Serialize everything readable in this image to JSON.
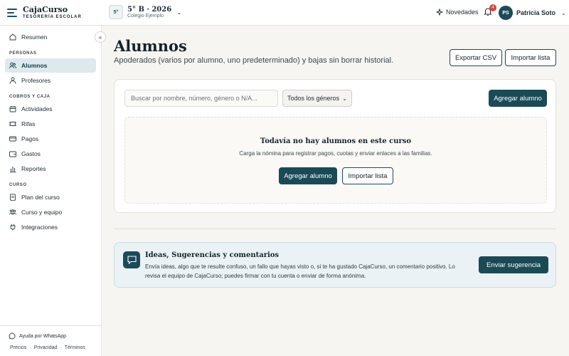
{
  "brand": {
    "name": "CajaCurso",
    "tagline": "TESORERÍA ESCOLAR"
  },
  "course": {
    "badge": "5°",
    "title": "5° B · 2026",
    "school": "Colegio Ejemplo"
  },
  "topbar": {
    "novedades": "Novedades",
    "notifications": "4",
    "avatar_initials": "PS",
    "user_name": "Patricia Soto"
  },
  "sidebar": {
    "collapse": "«",
    "items": {
      "resumen": "Resumen",
      "alumnos": "Alumnos",
      "profesores": "Profesores",
      "actividades": "Actividades",
      "rifas": "Rifas",
      "pagos": "Pagos",
      "gastos": "Gastos",
      "reportes": "Reportes",
      "plan": "Plan del curso",
      "equipo": "Curso y equipo",
      "integraciones": "Integraciones"
    },
    "sections": {
      "personas": "PERSONAS",
      "cobros": "COBROS Y CAJA",
      "curso": "CURSO"
    },
    "active": "alumnos",
    "help": "Ayuda por WhatsApp",
    "footer": {
      "precios": "Precios",
      "privacidad": "Privacidad",
      "terminos": "Términos",
      "sep": "·"
    }
  },
  "main": {
    "title": "Alumnos",
    "subtitle": "Apoderados (varios por alumno, uno predeterminado) y bajas sin borrar historial.",
    "export_label": "Exportar CSV",
    "import_label": "Importar lista",
    "search_placeholder": "Buscar por nombre, número, género o N/A...",
    "gender_filter": "Todos los géneros",
    "add_label": "Agregar alumno",
    "empty": {
      "title": "Todavía no hay alumnos en este curso",
      "subtitle": "Carga la nómina para registrar pagos, cuotas y enviar enlaces a las familias.",
      "add_label": "Agregar alumno",
      "import_label": "Importar lista"
    }
  },
  "feedback": {
    "title": "Ideas, Sugerencias y comentarios",
    "text": "Envía ideas, algo que te resulte confuso, un fallo que hayas visto o, si te ha gustado CajaCurso, un comentario positivo. Lo revisa el equipo de CajaCurso; puedes firmar con tu cuenta o enviar de forma anónima.",
    "button": "Enviar sugerencia"
  },
  "colors": {
    "primary": "#1a4a56",
    "accent_light": "#dde9ed",
    "badge_red": "#d4473b",
    "background": "#f6f5f1"
  }
}
